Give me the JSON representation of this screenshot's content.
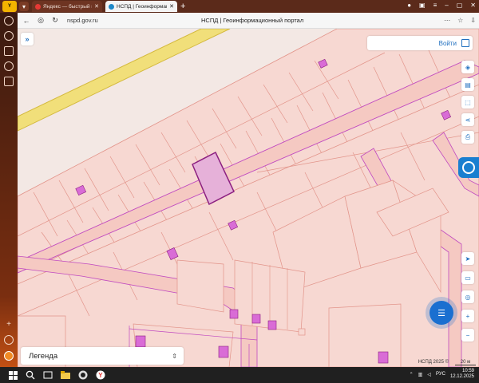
{
  "browser": {
    "logo_label": "Yandex",
    "tabs": [
      {
        "label": "Яндекс — быстрый поиск",
        "active": false
      },
      {
        "label": "НСПД | Геоинформационный",
        "active": true
      }
    ],
    "new_tab": "+",
    "url": "nspd.gov.ru",
    "page_title": "НСПД | Геоинформационный портал"
  },
  "map": {
    "login_label": "Войти",
    "legend_label": "Легенда",
    "attribution": "НСПД 2025 ©",
    "scale_label": "20 м",
    "colors": {
      "parcel_fill": "#f7d8d2",
      "parcel_stroke": "#e2948a",
      "road_fill": "#f5c9c2",
      "road_stroke": "#c04ac0",
      "building": "#d96cd6",
      "selected_fill": "#e6b1d9",
      "selected_stroke": "#8c2080",
      "highway_yellow": "#f1df7a",
      "accent": "#1f6fbf"
    }
  },
  "taskbar": {
    "lang": "РУС",
    "time": "10:59",
    "date": "12.12.2025"
  }
}
